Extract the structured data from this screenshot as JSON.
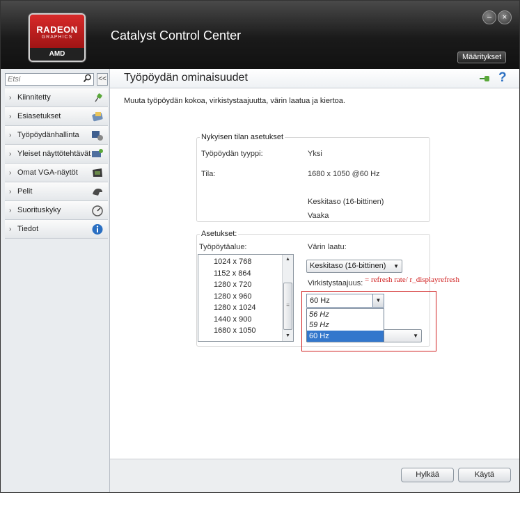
{
  "app": {
    "logo_line1": "RADEON",
    "logo_line2": "GRAPHICS",
    "logo_line3": "AMD",
    "title": "Catalyst Control Center",
    "preferences_label": "Määritykset"
  },
  "sidebar": {
    "search_placeholder": "Etsi",
    "collapse_label": "<<",
    "items": [
      {
        "label": "Kiinnitetty",
        "icon": "pin-icon"
      },
      {
        "label": "Esiasetukset",
        "icon": "presets-icon"
      },
      {
        "label": "Työpöydänhallinta",
        "icon": "desktop-management-icon"
      },
      {
        "label": "Yleiset näyttötehtävät",
        "icon": "display-tasks-icon"
      },
      {
        "label": "Omat VGA-näytöt",
        "icon": "vga-display-icon"
      },
      {
        "label": "Pelit",
        "icon": "gaming-icon"
      },
      {
        "label": "Suorituskyky",
        "icon": "performance-gauge-icon"
      },
      {
        "label": "Tiedot",
        "icon": "info-icon"
      }
    ]
  },
  "content": {
    "title": "Työpöydän ominaisuudet",
    "description": "Muuta työpöydän kokoa, virkistystaajuutta, värin laatua ja kiertoa.",
    "current": {
      "title": "Nykyisen tilan asetukset",
      "desktop_type_label": "Työpöydän tyyppi:",
      "desktop_type_value": "Yksi",
      "mode_label": "Tila:",
      "mode_value": "1680 x 1050 @60 Hz",
      "color_value": "Keskitaso (16-bittinen)",
      "rotation_value": "Vaaka"
    },
    "settings": {
      "title": "Asetukset:",
      "desktop_area_label": "Työpöytäalue:",
      "resolutions": [
        "1024 x 768",
        "1152 x 864",
        "1280 x 720",
        "1280 x 960",
        "1280 x 1024",
        "1440 x 900",
        "1680 x 1050"
      ],
      "color_quality_label": "Värin laatu:",
      "color_quality_value": "Keskitaso (16-bittinen)",
      "refresh_label": "Virkistystaajuus:",
      "refresh_value": "60 Hz",
      "refresh_options": [
        "56 Hz",
        "59 Hz",
        "60 Hz"
      ],
      "annotation": "= refresh rate/ r_displayrefresh"
    },
    "footer": {
      "discard_label": "Hylkää",
      "apply_label": "Käytä"
    }
  },
  "colors": {
    "accent_red": "#d02020",
    "selection_blue": "#3377cc"
  }
}
